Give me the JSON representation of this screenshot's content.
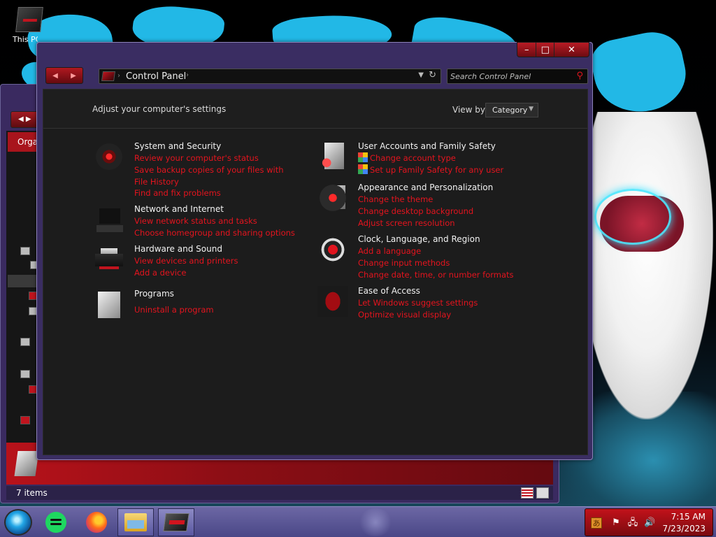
{
  "desktop": {
    "icon_label": "This PC"
  },
  "background_window": {
    "toolbar_label": "Organize",
    "status_text": "7 items"
  },
  "control_panel": {
    "address": {
      "crumb": "Control Panel",
      "search_placeholder": "Search Control Panel"
    },
    "header": {
      "adjust_text": "Adjust your computer's settings",
      "view_by_label": "View by:",
      "view_by_value": "Category"
    },
    "categories_left": [
      {
        "title": "System and Security",
        "icon": "shield-icon",
        "links": [
          "Review your computer's status",
          "Save backup copies of your files with File History",
          "Find and fix problems"
        ]
      },
      {
        "title": "Network and Internet",
        "icon": "network-icon",
        "links": [
          "View network status and tasks",
          "Choose homegroup and sharing options"
        ]
      },
      {
        "title": "Hardware and Sound",
        "icon": "printer-icon",
        "links": [
          "View devices and printers",
          "Add a device"
        ]
      },
      {
        "title": "Programs",
        "icon": "programs-icon",
        "links": [
          "Uninstall a program"
        ]
      }
    ],
    "categories_right": [
      {
        "title": "User Accounts and Family Safety",
        "icon": "users-icon",
        "links": [
          "Change account type",
          "Set up Family Safety for any user"
        ]
      },
      {
        "title": "Appearance and Personalization",
        "icon": "appearance-icon",
        "links": [
          "Change the theme",
          "Change desktop background",
          "Adjust screen resolution"
        ]
      },
      {
        "title": "Clock, Language, and Region",
        "icon": "clock-icon",
        "links": [
          "Add a language",
          "Change input methods",
          "Change date, time, or number formats"
        ]
      },
      {
        "title": "Ease of Access",
        "icon": "ease-of-access-icon",
        "links": [
          "Let Windows suggest settings",
          "Optimize visual display"
        ]
      }
    ]
  },
  "taskbar": {
    "clock_time": "7:15 AM",
    "clock_date": "7/23/2023"
  },
  "colors": {
    "accent_red": "#e4141e",
    "window_frame": "#3a2d62",
    "taskbar": "#5a57a0"
  }
}
